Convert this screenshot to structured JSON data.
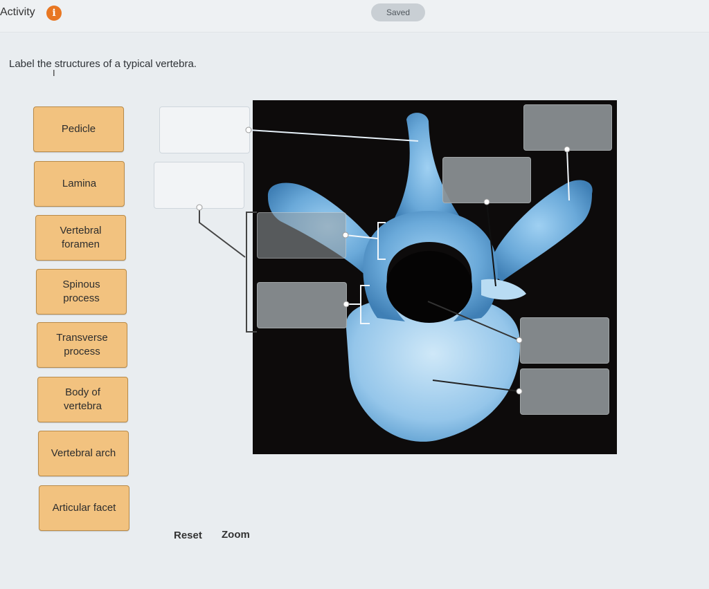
{
  "header": {
    "title": "Activity",
    "info_icon": "info-icon",
    "saved_label": "Saved"
  },
  "instruction": "Label the structures of a typical vertebra.",
  "labels": [
    "Pedicle",
    "Lamina",
    "Vertebral\nforamen",
    "Spinous\nprocess",
    "Transverse\nprocess",
    "Body of\nvertebra",
    "Vertebral arch",
    "Articular facet"
  ],
  "dropzones": [
    "",
    "",
    "",
    "",
    "",
    "",
    "",
    ""
  ],
  "controls": {
    "reset_label": "Reset",
    "zoom_label": "Zoom"
  },
  "colors": {
    "chip_fill": "#f2c27f",
    "info_icon": "#e87722",
    "bone": "#7fb8e4"
  }
}
